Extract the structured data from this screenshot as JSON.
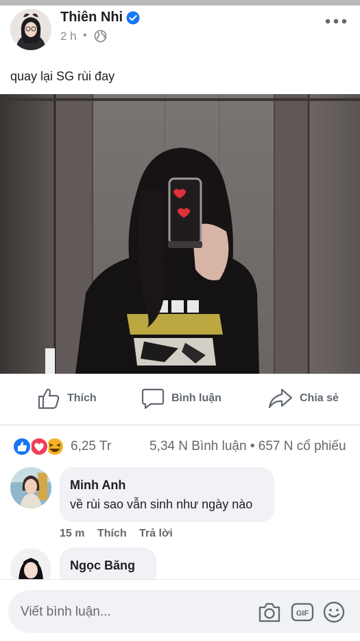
{
  "post": {
    "author": "Thiên Nhi",
    "time": "2 h",
    "dot": "•",
    "privacy_icon": "globe-icon",
    "text": "quay lại SG rùi đay"
  },
  "actions": {
    "like": "Thích",
    "comment": "Bình luận",
    "share": "Chia sẻ"
  },
  "reactions": {
    "count": "6,25 Tr",
    "stats": "5,34 N Bình luận • 657 N cổ phiếu",
    "icons": [
      "like-icon",
      "love-icon",
      "haha-icon"
    ]
  },
  "comments": [
    {
      "name": "Minh Anh",
      "text": "về rùi sao vẫn sinh như ngày nào",
      "time": "15 m",
      "like": "Thích",
      "reply": "Trả lời"
    },
    {
      "name": "Ngọc Băng"
    }
  ],
  "composer": {
    "placeholder": "Viết bình luận...",
    "camera_icon": "camera-icon",
    "gif_label": "GIF",
    "emoji_icon": "emoji-icon"
  },
  "colors": {
    "accent": "#1877f2",
    "muted": "#65676b",
    "bubble": "#f0f2f5"
  }
}
